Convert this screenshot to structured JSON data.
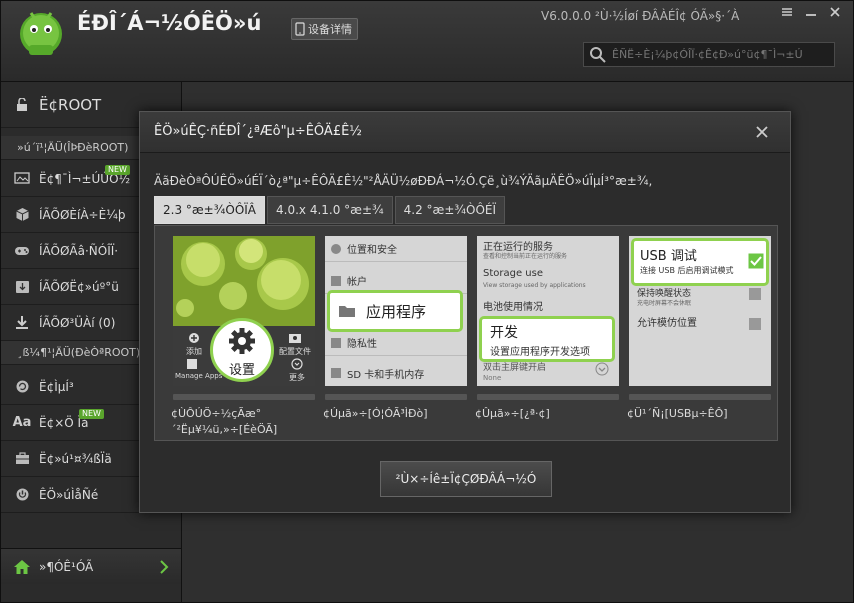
{
  "header": {
    "app_title": "ÉÐÎ´Á¬½ÓÊÖ»ú",
    "device_button": "设备详情",
    "version": "V6.0.0.0 ²Ù·½Íøí ÐÂÀÉÎ¢ ÓÃ»§·´À",
    "search_placeholder": "ÊÑË÷È¡¼þ¢ÓÎÏ·¢Ê¢Ð»ú°ü¢¶¯Ì¬±Ú"
  },
  "sidebar": {
    "items": [
      {
        "label": "Ë¢ROOT",
        "icon": "unlock-icon"
      },
      {
        "label": "»ú´ï¹¦ÄÜ(ÎÞÐèROOT)",
        "icon": ""
      },
      {
        "label": "Ë¢¶¯Ì¬±ÚÚÖ½",
        "icon": "wallpaper-icon",
        "badge": "NEW"
      },
      {
        "label": "ÍÃÕØÈíÀ÷È¼þ",
        "icon": "box-icon"
      },
      {
        "label": "ÍÃÕØÃâ·ÑÓÎÏ·",
        "icon": "gamepad-icon"
      },
      {
        "label": "ÍÃÕØË¢»úº°ü",
        "icon": "download-box-icon"
      },
      {
        "label": "ÍÃÕØ³ÜÀí (0)",
        "icon": "download-icon"
      },
      {
        "label": "¸ß¼¶¹¦ÄÜ(ÐèÒªROOT)",
        "icon": ""
      },
      {
        "label": "Ë¢ÌµÍ³",
        "icon": "refresh-icon"
      },
      {
        "label": "Ë¢×Ö Ìå",
        "icon": "font-icon",
        "badge": "NEW"
      },
      {
        "label": "Ë¢»ú¹¤¾ßÏä",
        "icon": "toolbox-icon"
      },
      {
        "label": "ÊÖ»úÌåÑé",
        "icon": "power-icon"
      }
    ],
    "home_label": "»¶ÓÊ¹ÓÃ"
  },
  "dialog": {
    "title": "ÊÖ»úÊÇ·ñÉÐÎ´¿ªÆô\"µ÷ÊÔÄ£Ê½",
    "description": "ÄãÐèÒªÔÚÊÖ»úÉÏ´ò¿ª\"µ÷ÊÔÄ£Ê½\"²ÅÄÜ½øÐÐÁ¬½Ó.Çë¸ù¾ÝÄãµÄÊÖ»úÏµÍ³°æ±¾,",
    "tabs": [
      {
        "label": "2.3 °æ±¾ÒÔÏÂ",
        "active": true
      },
      {
        "label": "4.0.x 4.1.0 °æ±¾",
        "active": false
      },
      {
        "label": "4.2 °æ±¾ÒÔÉÏ",
        "active": false
      }
    ],
    "steps": [
      {
        "caption": "¢ÙÔÚÖ÷½çÃæ°´²Ëµ¥¼ü,»÷[ÉèÖÃ]",
        "phone_labels": [
          "设置",
          "添加",
          "配置文件",
          "Manage Apps",
          "更多"
        ]
      },
      {
        "caption": "¢Úµã»÷[Ó¦ÓÃ³ÌÐò]",
        "phone_labels": [
          "位置和安全",
          "帐户",
          "应用程序",
          "隐私性",
          "SD 卡和手机内存"
        ]
      },
      {
        "caption": "¢Ûµã»÷[¿ª·¢]",
        "phone_labels": [
          "正在运行的服务",
          "查看和控制当前正在运行的服务",
          "Storage use",
          "View storage used by applications",
          "电池使用情况",
          "开发",
          "设置应用程序开发选项",
          "双击主屏键开启",
          "None"
        ]
      },
      {
        "caption": "¢Ü¹´Ñ¡[USBµ÷ÊÔ]",
        "phone_labels": [
          "USB 调试",
          "连接 USB 后启用调试模式",
          "保持唤醒状态",
          "充电时屏幕不会休眠",
          "允许模仿位置"
        ]
      }
    ],
    "finish_button": "²Ù×÷Íê±Ï¢ÇØÐÂÁ¬½Ó"
  },
  "colors": {
    "accent_green": "#6cc644",
    "highlight_border": "#8fd14f"
  }
}
